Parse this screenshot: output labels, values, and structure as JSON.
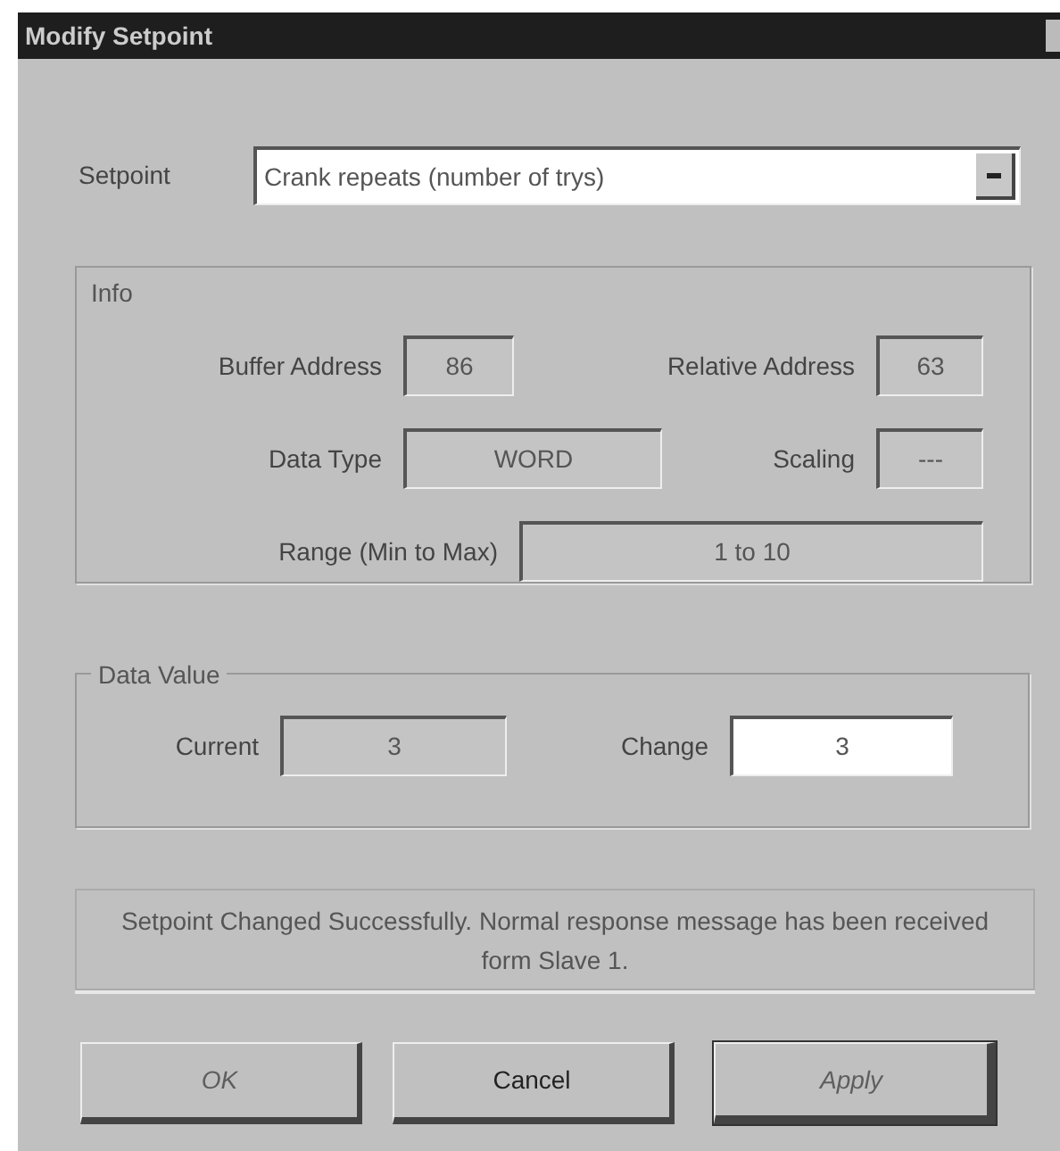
{
  "window": {
    "title": "Modify Setpoint"
  },
  "setpoint": {
    "label": "Setpoint",
    "value": "Crank repeats (number of trys)"
  },
  "info": {
    "title": "Info",
    "buffer_address": {
      "label": "Buffer Address",
      "value": "86"
    },
    "relative_address": {
      "label": "Relative Address",
      "value": "63"
    },
    "data_type": {
      "label": "Data Type",
      "value": "WORD"
    },
    "scaling": {
      "label": "Scaling",
      "value": "---"
    },
    "range": {
      "label": "Range (Min to Max)",
      "value": "1 to 10"
    }
  },
  "data_value": {
    "title": "Data Value",
    "current": {
      "label": "Current",
      "value": "3"
    },
    "change": {
      "label": "Change",
      "value": "3"
    }
  },
  "message": "Setpoint Changed Successfully. Normal response message has been received form Slave 1.",
  "buttons": [
    {
      "label": "OK",
      "disabled": true,
      "default": false
    },
    {
      "label": "Cancel",
      "disabled": false,
      "default": false
    },
    {
      "label": "Apply",
      "disabled": true,
      "default": true
    }
  ]
}
